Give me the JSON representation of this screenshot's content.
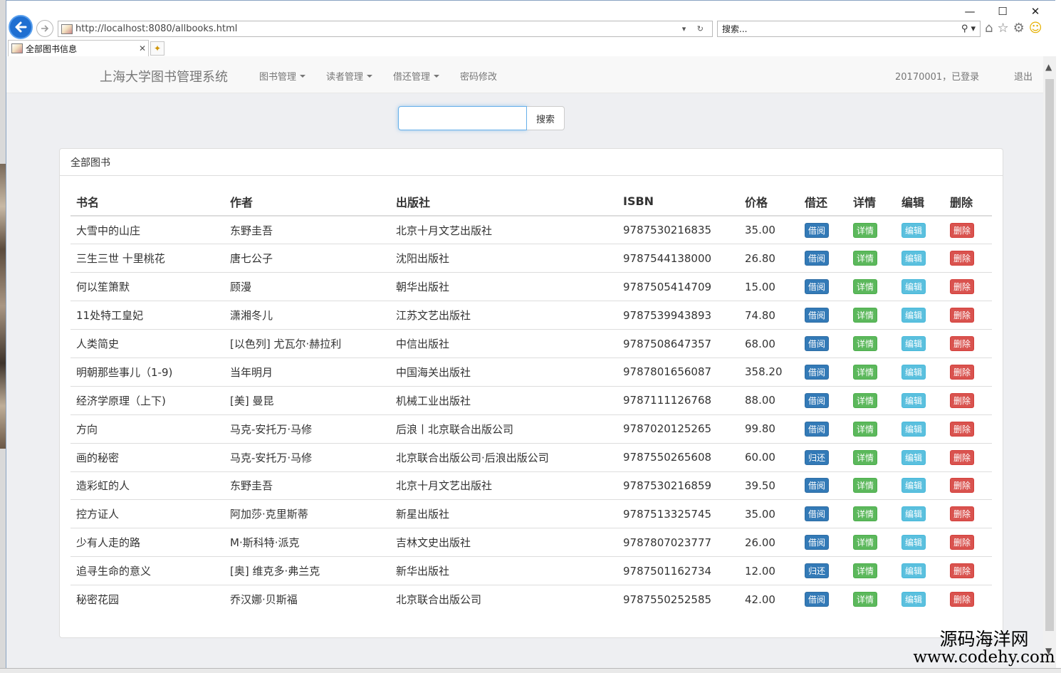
{
  "browser": {
    "url": "http://localhost:8080/allbooks.html",
    "search_placeholder": "搜索...",
    "tab_title": "全部图书信息",
    "minimize": "—",
    "maximize": "☐",
    "close": "✕"
  },
  "navbar": {
    "brand": "上海大学图书管理系统",
    "menus": [
      {
        "label": "图书管理",
        "dropdown": true
      },
      {
        "label": "读者管理",
        "dropdown": true
      },
      {
        "label": "借还管理",
        "dropdown": true
      },
      {
        "label": "密码修改",
        "dropdown": false
      }
    ],
    "user_status": "20170001，已登录",
    "logout": "退出"
  },
  "search": {
    "value": "",
    "button": "搜索"
  },
  "panel": {
    "title": "全部图书"
  },
  "table": {
    "headers": [
      "书名",
      "作者",
      "出版社",
      "ISBN",
      "价格",
      "借还",
      "详情",
      "编辑",
      "删除"
    ],
    "detail_label": "详情",
    "edit_label": "编辑",
    "delete_label": "删除",
    "rows": [
      {
        "name": "大雪中的山庄",
        "author": "东野圭吾",
        "publisher": "北京十月文艺出版社",
        "isbn": "9787530216835",
        "price": "35.00",
        "action": "借阅"
      },
      {
        "name": "三生三世 十里桃花",
        "author": "唐七公子",
        "publisher": "沈阳出版社",
        "isbn": "9787544138000",
        "price": "26.80",
        "action": "借阅"
      },
      {
        "name": "何以笙箫默",
        "author": "顾漫",
        "publisher": "朝华出版社",
        "isbn": "9787505414709",
        "price": "15.00",
        "action": "借阅"
      },
      {
        "name": "11处特工皇妃",
        "author": "潇湘冬儿",
        "publisher": "江苏文艺出版社",
        "isbn": "9787539943893",
        "price": "74.80",
        "action": "借阅"
      },
      {
        "name": "人类简史",
        "author": "[以色列] 尤瓦尔·赫拉利",
        "publisher": "中信出版社",
        "isbn": "9787508647357",
        "price": "68.00",
        "action": "借阅"
      },
      {
        "name": "明朝那些事儿（1-9)",
        "author": "当年明月",
        "publisher": "中国海关出版社",
        "isbn": "9787801656087",
        "price": "358.20",
        "action": "借阅"
      },
      {
        "name": "经济学原理（上下)",
        "author": "[美] 曼昆",
        "publisher": "机械工业出版社",
        "isbn": "9787111126768",
        "price": "88.00",
        "action": "借阅"
      },
      {
        "name": "方向",
        "author": "马克-安托万·马修",
        "publisher": "后浪丨北京联合出版公司",
        "isbn": "9787020125265",
        "price": "99.80",
        "action": "借阅"
      },
      {
        "name": "画的秘密",
        "author": "马克-安托万·马修",
        "publisher": "北京联合出版公司·后浪出版公司",
        "isbn": "9787550265608",
        "price": "60.00",
        "action": "归还"
      },
      {
        "name": "造彩虹的人",
        "author": "东野圭吾",
        "publisher": "北京十月文艺出版社",
        "isbn": "9787530216859",
        "price": "39.50",
        "action": "借阅"
      },
      {
        "name": "控方证人",
        "author": "阿加莎·克里斯蒂",
        "publisher": "新星出版社",
        "isbn": "9787513325745",
        "price": "35.00",
        "action": "借阅"
      },
      {
        "name": "少有人走的路",
        "author": "M·斯科特·派克",
        "publisher": "吉林文史出版社",
        "isbn": "9787807023777",
        "price": "26.00",
        "action": "借阅"
      },
      {
        "name": "追寻生命的意义",
        "author": "[奥] 维克多·弗兰克",
        "publisher": "新华出版社",
        "isbn": "9787501162734",
        "price": "12.00",
        "action": "归还"
      },
      {
        "name": "秘密花园",
        "author": "乔汉娜·贝斯福",
        "publisher": "北京联合出版公司",
        "isbn": "9787550252585",
        "price": "42.00",
        "action": "借阅"
      }
    ]
  },
  "watermark": {
    "line1": "源码海洋网",
    "line2": "www.codehy.com"
  }
}
